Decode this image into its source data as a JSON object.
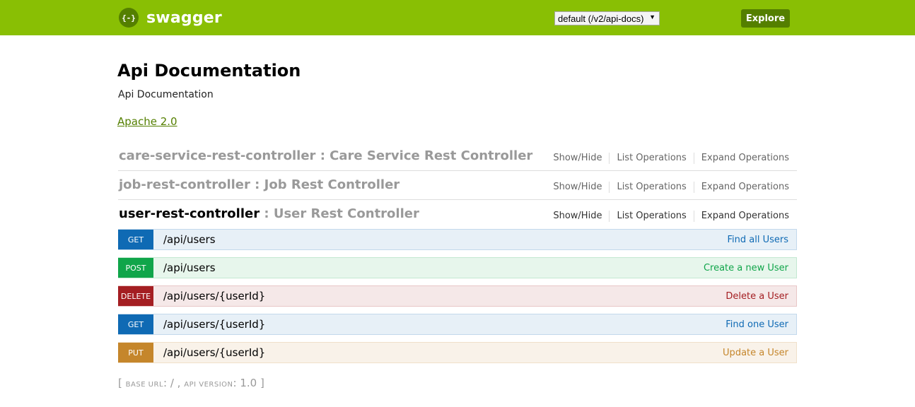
{
  "header": {
    "logo_symbol": "{-}",
    "logo_text": "swagger",
    "spec_select_value": "default (/v2/api-docs)",
    "explore_label": "Explore",
    "bg_color": "#89bf04"
  },
  "info": {
    "title": "Api Documentation",
    "description": "Api Documentation",
    "license": "Apache 2.0"
  },
  "resources": [
    {
      "name": "care-service-rest-controller",
      "desc": ": Care Service Rest Controller",
      "opt_showhide": "Show/Hide",
      "opt_list": "List Operations",
      "opt_expand": "Expand Operations"
    },
    {
      "name": "job-rest-controller",
      "desc": ": Job Rest Controller",
      "opt_showhide": "Show/Hide",
      "opt_list": "List Operations",
      "opt_expand": "Expand Operations"
    },
    {
      "name": "user-rest-controller",
      "desc": ": User Rest Controller",
      "opt_showhide": "Show/Hide",
      "opt_list": "List Operations",
      "opt_expand": "Expand Operations"
    }
  ],
  "operations": [
    {
      "method": "GET",
      "path": "/api/users",
      "summary": "Find all Users"
    },
    {
      "method": "POST",
      "path": "/api/users",
      "summary": "Create a new User"
    },
    {
      "method": "DELETE",
      "path": "/api/users/{userId}",
      "summary": "Delete a User"
    },
    {
      "method": "GET",
      "path": "/api/users/{userId}",
      "summary": "Find one User"
    },
    {
      "method": "PUT",
      "path": "/api/users/{userId}",
      "summary": "Update a User"
    }
  ],
  "footer": {
    "open_bracket": "[",
    "base_url_label": "base url",
    "base_url_value": ": / ,",
    "api_version_label": "api version",
    "api_version_value": ": 1.0",
    "close_bracket": "]"
  }
}
